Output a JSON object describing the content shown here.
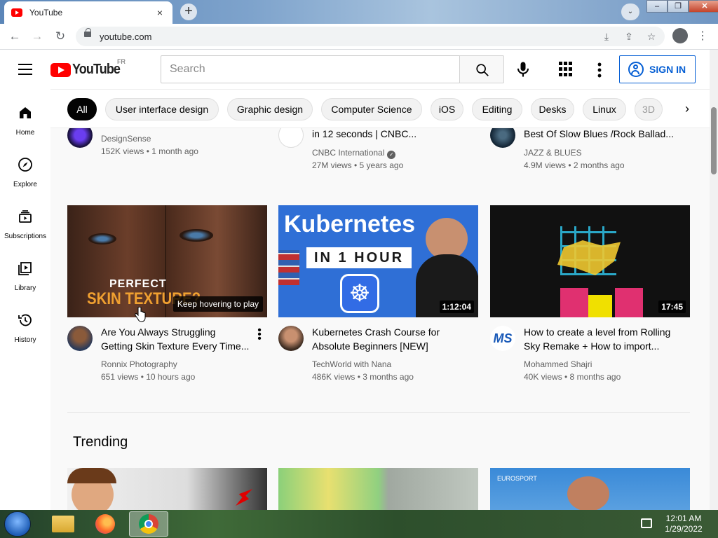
{
  "browser": {
    "tab_title": "YouTube",
    "tab_close": "×",
    "new_tab": "+",
    "tab_search": "⌄",
    "url": "youtube.com",
    "win_minimize": "‒",
    "win_maximize": "❐",
    "win_close": "✕",
    "back": "←",
    "forward": "→",
    "reload": "↻"
  },
  "masthead": {
    "logo_text": "YouTube",
    "country_code": "FR",
    "search_placeholder": "Search",
    "sign_in_label": "SIGN IN"
  },
  "chips": [
    {
      "label": "All",
      "active": true
    },
    {
      "label": "User interface design"
    },
    {
      "label": "Graphic design"
    },
    {
      "label": "Computer Science"
    },
    {
      "label": "iOS"
    },
    {
      "label": "Editing"
    },
    {
      "label": "Desks"
    },
    {
      "label": "Linux"
    },
    {
      "label": "3D"
    }
  ],
  "guide": [
    {
      "label": "Home",
      "icon": "home-icon"
    },
    {
      "label": "Explore",
      "icon": "compass-icon"
    },
    {
      "label": "Subscriptions",
      "icon": "subscriptions-icon"
    },
    {
      "label": "Library",
      "icon": "library-icon"
    },
    {
      "label": "History",
      "icon": "history-icon"
    }
  ],
  "top_row": [
    {
      "title_line2": "",
      "channel": "DesignSense",
      "meta": "152K views • 1 month ago"
    },
    {
      "title_line2": "in 12 seconds | CNBC...",
      "channel": "CNBC International",
      "meta": "27M views • 5 years ago"
    },
    {
      "title_line2": "Best Of Slow Blues /Rock Ballad...",
      "channel": "JAZZ & BLUES",
      "meta": "4.9M views • 2 months ago"
    }
  ],
  "videos": [
    {
      "title_line1": "Are You Always Struggling",
      "title_line2": "Getting Skin Texture Every Time...",
      "channel": "Ronnix Photography",
      "meta": "651 views • 10 hours ago",
      "thumb_text1": "PERFECT",
      "thumb_text2": "SKIN TEXTURE?",
      "hover_label": "Keep hovering to play"
    },
    {
      "title_line1": "Kubernetes Crash Course for",
      "title_line2": "Absolute Beginners [NEW]",
      "channel": "TechWorld with Nana",
      "meta": "486K views • 3 months ago",
      "duration": "1:12:04",
      "thumb_text1": "Kubernetes",
      "thumb_text2": "IN 1 HOUR"
    },
    {
      "title_line1": "How to create a level from Rolling",
      "title_line2": "Sky Remake + How to import...",
      "channel": "Mohammed Shajri",
      "meta": "40K views • 8 months ago",
      "duration": "17:45",
      "avatar_text": "MS"
    }
  ],
  "trending": {
    "section_title": "Trending"
  },
  "taskbar": {
    "time": "12:01 AM",
    "date": "1/29/2022"
  },
  "colors": {
    "yt_red": "#ff0000",
    "link_blue": "#065fd4",
    "chip_active": "#030303"
  }
}
